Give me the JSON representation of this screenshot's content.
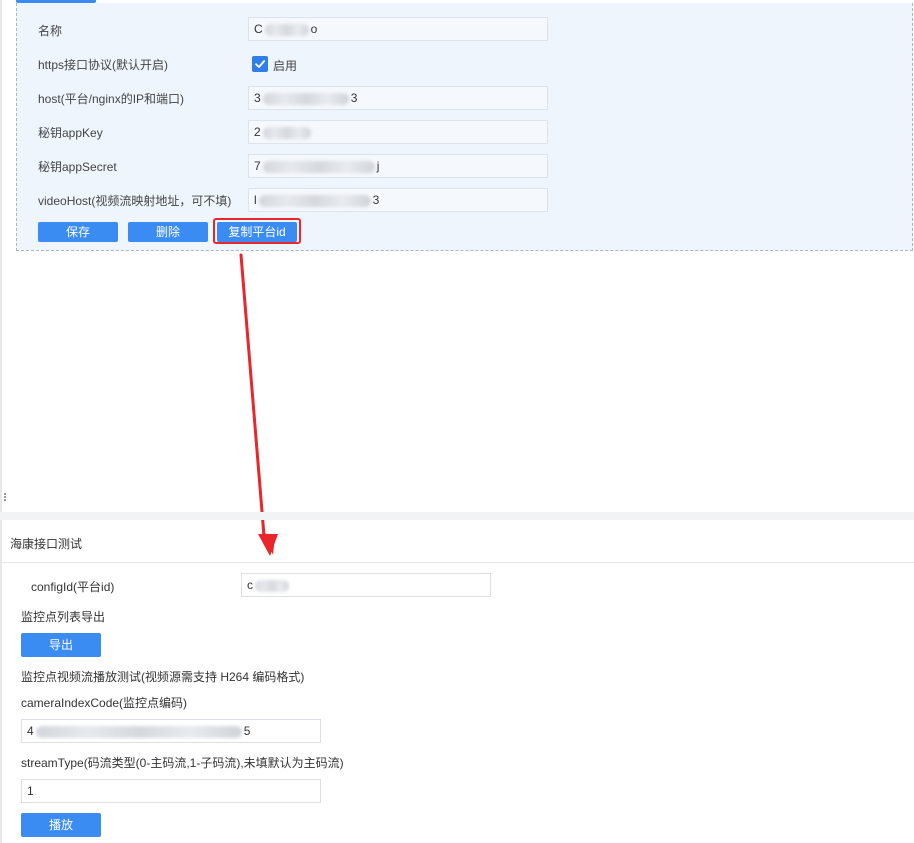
{
  "config_form": {
    "fields": [
      {
        "label": "名称",
        "value_start": "C",
        "value_end": "o"
      },
      {
        "label": "https接口协议(默认开启)"
      },
      {
        "label": "host(平台/nginx的IP和端口)",
        "value_start": "3",
        "value_end": "3"
      },
      {
        "label": "秘钥appKey",
        "value_start": "2",
        "value_end": ""
      },
      {
        "label": "秘钥appSecret",
        "value_start": "7",
        "value_end": "j"
      },
      {
        "label": "videoHost(视频流映射地址，可不填)",
        "value_start": "l",
        "value_end": "3"
      }
    ],
    "https_checkbox": {
      "checked": true,
      "label": "启用"
    },
    "buttons": {
      "save": "保存",
      "delete": "删除",
      "copy_id": "复制平台id"
    }
  },
  "annotation": {
    "highlight_color": "#e8262b"
  },
  "test_section": {
    "title": "海康接口测试",
    "config_id_label": "configId(平台id)",
    "config_id_value_start": "c",
    "export_label": "监控点列表导出",
    "export_button": "导出",
    "play_test_label": "监控点视频流播放测试(视频源需支持 H264 编码格式)",
    "camera_code_label": "cameraIndexCode(监控点编码)",
    "camera_code_value_start": "4",
    "camera_code_value_end": "5",
    "stream_type_label": "streamType(码流类型(0-主码流,1-子码流),未填默认为主码流)",
    "stream_type_value": "1",
    "play_button": "播放"
  },
  "colors": {
    "primary": "#3b8cf2",
    "panel_bg": "#eef5fd",
    "highlight": "#e8262b"
  }
}
